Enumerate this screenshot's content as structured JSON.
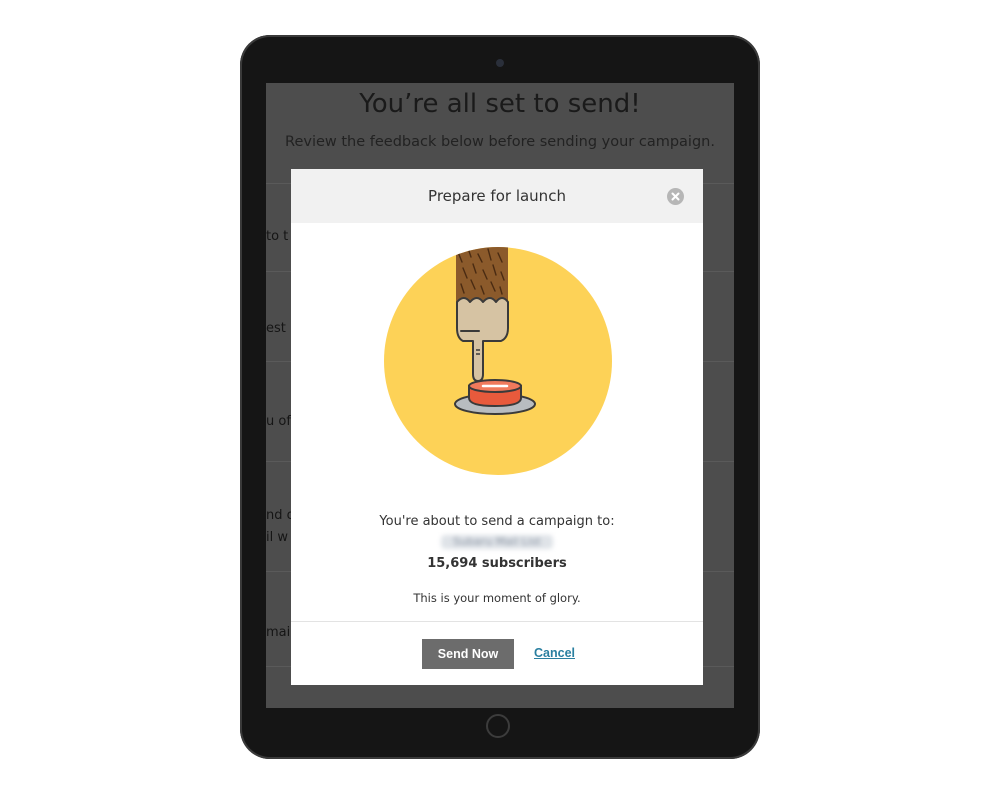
{
  "background_page": {
    "title": "You’re all set to send!",
    "subtitle": "Review the feedback below before sending your campaign.",
    "fragments": [
      "to t",
      "est",
      "u of",
      "nd o",
      "il w",
      "mail"
    ]
  },
  "modal": {
    "title": "Prepare for launch",
    "close_icon": "close-icon",
    "illustration": "finger-pressing-red-button",
    "about_text": "You're about to send a campaign to:",
    "list_name": "Subaru Mail List",
    "subscribers": "15,694 subscribers",
    "tagline": "This is your moment of glory.",
    "send_label": "Send Now",
    "cancel_label": "Cancel"
  },
  "colors": {
    "circle": "#fdd257",
    "button_red": "#e85a3c",
    "send_button": "#6c6c6c",
    "cancel_link": "#2a7fa0",
    "overlay": "#4d4d4d"
  }
}
